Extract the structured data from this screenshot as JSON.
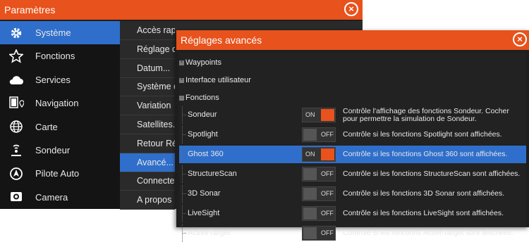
{
  "parametres": {
    "title": "Paramètres",
    "close_label": "×",
    "sidebar": [
      {
        "label": "Système",
        "icon": "gear-icon",
        "selected": true
      },
      {
        "label": "Fonctions",
        "icon": "star-icon"
      },
      {
        "label": "Services",
        "icon": "cloud-icon"
      },
      {
        "label": "Navigation",
        "icon": "navigation-icon"
      },
      {
        "label": "Carte",
        "icon": "globe-icon"
      },
      {
        "label": "Sondeur",
        "icon": "sonar-icon"
      },
      {
        "label": "Pilote Auto",
        "icon": "autopilot-icon"
      },
      {
        "label": "Camera",
        "icon": "camera-icon"
      }
    ],
    "submenu": [
      {
        "label": "Accès rapide"
      },
      {
        "label": "Réglage de"
      },
      {
        "label": "Datum..."
      },
      {
        "label": "Système de"
      },
      {
        "label": "Variation"
      },
      {
        "label": "Satellites..."
      },
      {
        "label": "Retour Ré"
      },
      {
        "label": "Avancé...",
        "selected": true
      },
      {
        "label": "Connecter"
      },
      {
        "label": "A propos"
      }
    ]
  },
  "reglages": {
    "title": "Réglages avancés",
    "close_label": "×",
    "tree": [
      {
        "label": "Waypoints",
        "toggle": "+"
      },
      {
        "label": "Interface utilisateur",
        "toggle": "+"
      },
      {
        "label": "Fonctions",
        "toggle": "-"
      }
    ],
    "settings": [
      {
        "name": "Sondeur",
        "state": "ON",
        "desc": "Contrôle l'affichage des fonctions Sondeur. Cocher pour permettre la simulation de Sondeur."
      },
      {
        "name": "Spotlight",
        "state": "OFF",
        "desc": "Contrôle si les fonctions Spotlight sont affichées."
      },
      {
        "name": "Ghost 360",
        "state": "ON",
        "desc": "Contrôle si les fonctions Ghost 360 sont affichées.",
        "selected": true
      },
      {
        "name": "StructureScan",
        "state": "OFF",
        "desc": "Contrôle si les fonctions StructureScan sont affichées."
      },
      {
        "name": "3D Sonar",
        "state": "OFF",
        "desc": "Contrôle si les fonctions 3D Sonar sont affichées."
      },
      {
        "name": "LiveSight",
        "state": "OFF",
        "desc": "Contrôle si les fonctions LiveSight sont affichées."
      },
      {
        "name": "ActiveTarget",
        "state": "OFF",
        "desc": "Contrôle si les fonctions ActiveTarget sont affichées."
      }
    ]
  },
  "colors": {
    "accent": "#e8521c",
    "selection": "#2f6fcb",
    "toggle_on": "#e8521c",
    "toggle_off": "#555555"
  }
}
